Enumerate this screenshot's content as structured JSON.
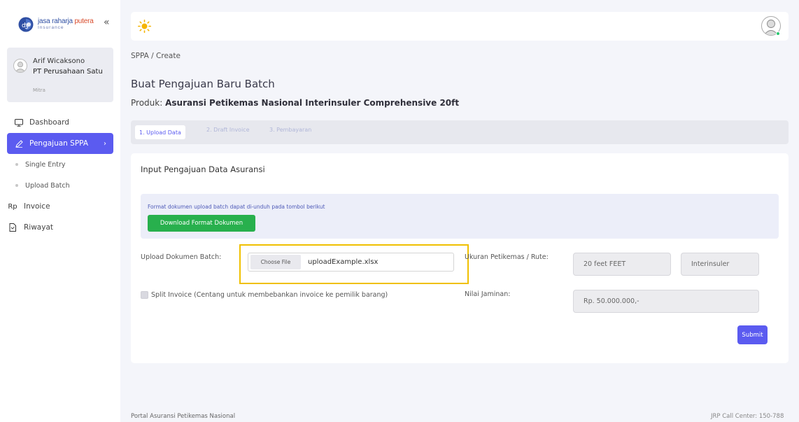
{
  "brand": {
    "name_part1": "jasa raharja ",
    "name_part2": "putera",
    "sub": "Insurance",
    "collapse_glyph": "«"
  },
  "user": {
    "name": "Arif Wicaksono",
    "company": "PT Perusahaan Satu",
    "role": "Mitra"
  },
  "sidebar": {
    "items": [
      {
        "label": "Dashboard",
        "icon": "monitor-icon"
      },
      {
        "label": "Pengajuan SPPA",
        "icon": "pencil-icon",
        "active": true
      },
      {
        "label": "Single Entry",
        "sub": true
      },
      {
        "label": "Upload Batch",
        "sub": true
      },
      {
        "label": "Invoice",
        "icon": "rupiah-icon",
        "icon_text": "Rp"
      },
      {
        "label": "Riwayat",
        "icon": "document-icon"
      }
    ]
  },
  "breadcrumb": "SPPA / Create",
  "page": {
    "title": "Buat Pengajuan Baru Batch",
    "product_label": "Produk:",
    "product_name": "Asuransi Petikemas Nasional Interinsuler Comprehensive 20ft"
  },
  "steps": [
    "1. Upload Data",
    "2. Draft Invoice",
    "3. Pembayaran"
  ],
  "form": {
    "title": "Input Pengajuan Data Asuransi",
    "alert_text": "Format dokumen upload batch dapat di-unduh pada tombol berikut",
    "download_label": "Download Format Dokumen",
    "upload_label": "Upload Dokumen Batch:",
    "choose_file_label": "Choose File",
    "file_name": "uploadExample.xlsx",
    "ukuran_label": "Ukuran Petikemas / Rute:",
    "ukuran_value": "20 feet FEET",
    "rute_value": "Interinsuler",
    "split_label": "Split Invoice (Centang untuk membebankan invoice ke pemilik barang)",
    "split_checked": false,
    "nilai_label": "Nilai Jaminan:",
    "nilai_value": "Rp. 50.000.000,-",
    "submit_label": "Submit"
  },
  "footer": {
    "left": "Portal Asuransi Petikemas Nasional",
    "right": "JRP Call Center: 150-788"
  },
  "colors": {
    "accent": "#5b5bf0",
    "success": "#28b04d",
    "highlight": "#f0c000"
  }
}
